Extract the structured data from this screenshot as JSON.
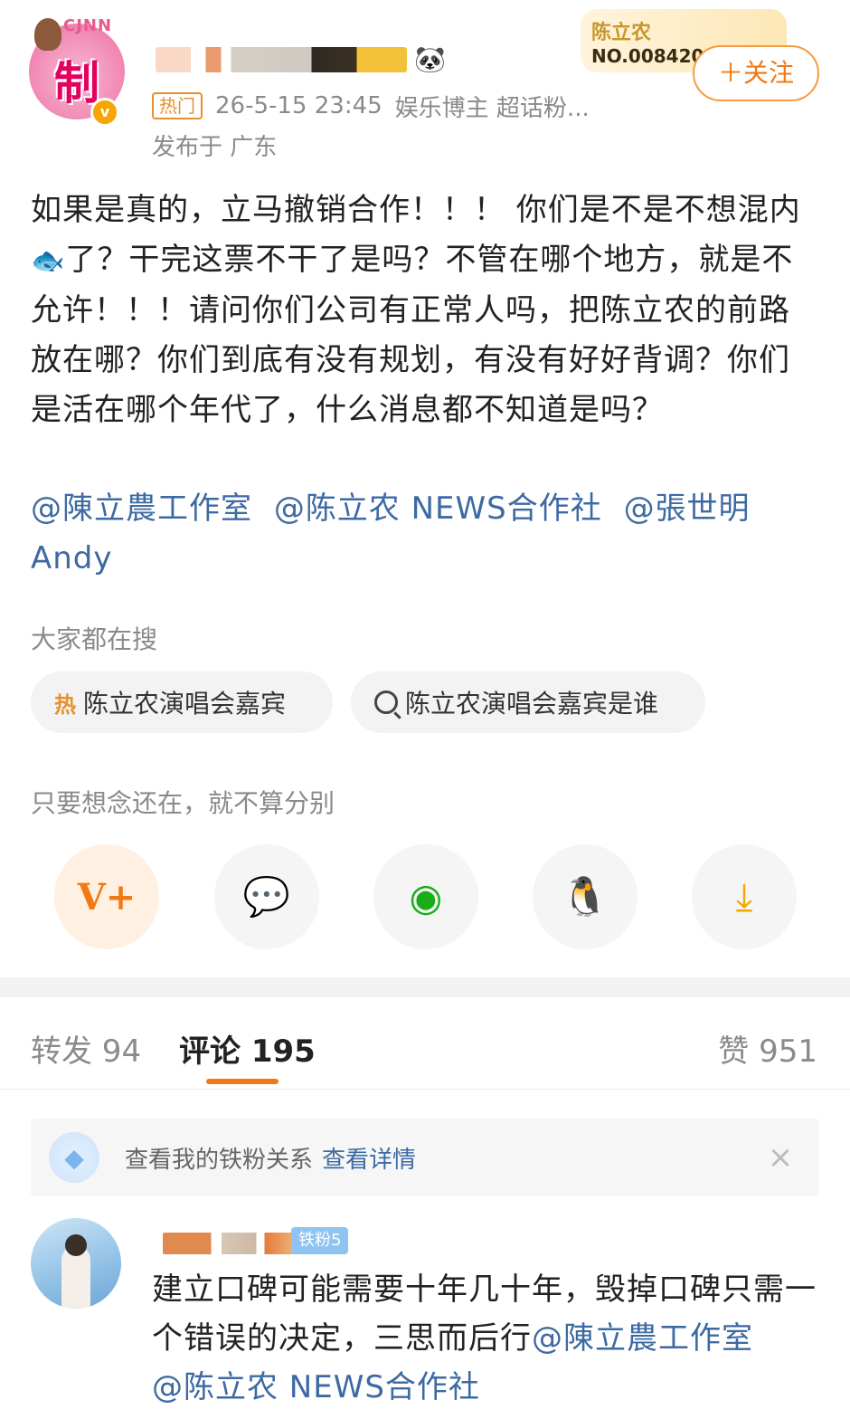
{
  "post": {
    "author": {
      "verified_mark": "v",
      "avatar_logo_text": "CJNN",
      "avatar_logo_word": "制",
      "fan_badge_name": "陈立农",
      "fan_badge_no": "NO.008420"
    },
    "follow_label": "＋关注",
    "hot_tag": "热门",
    "timestamp": "26-5-15 23:45",
    "author_desc": "娱乐博主 超话粉...",
    "location": "发布于 广东",
    "body_part1": "如果是真的，立马撤销合作！！！ 你们是不是不想混内",
    "fish_emoji": "🐟",
    "body_part2": "了？干完这票不干了是吗？不管在哪个地方，就是不允许！！！请问你们公司有正常人吗，把陈立农的前路放在哪？你们到底有没有规划，有没有好好背调？你们是活在哪个年代了，什么消息都不知道是吗？",
    "mentions": [
      "@陳立農工作室",
      "@陈立农 NEWS合作社",
      "@張世明Andy"
    ]
  },
  "search": {
    "title": "大家都在搜",
    "chips": [
      {
        "label": "陈立农演唱会嘉宾",
        "icon": "hot-search-icon",
        "icon_glyph": "热"
      },
      {
        "label": "陈立农演唱会嘉宾是谁",
        "icon": "search-icon"
      }
    ]
  },
  "share": {
    "hint": "只要想念还在，就不算分别",
    "buttons": [
      {
        "name": "vplus",
        "glyph": "V+"
      },
      {
        "name": "wechat",
        "glyph": "💬"
      },
      {
        "name": "moments",
        "glyph": "◉"
      },
      {
        "name": "qq",
        "glyph": "🐧"
      },
      {
        "name": "save",
        "glyph": "⤓"
      }
    ]
  },
  "tabs": {
    "repost": "转发 94",
    "comment": "评论 195",
    "like": "赞 951"
  },
  "fan_bar": {
    "text": "查看我的铁粉关系",
    "link": "查看详情",
    "close": "×"
  },
  "comment": {
    "badge": "铁粉5",
    "text_part1": "建立口碑可能需要十年几十年，毁掉口碑只需一个错误的决定，三思而后行",
    "mention1": "@陳立農工作室",
    "mention2": "@陈立农 NEWS合作社"
  },
  "colors": {
    "accent": "#f07a16",
    "link": "#3d6aa3",
    "muted": "#8a8a8a"
  }
}
